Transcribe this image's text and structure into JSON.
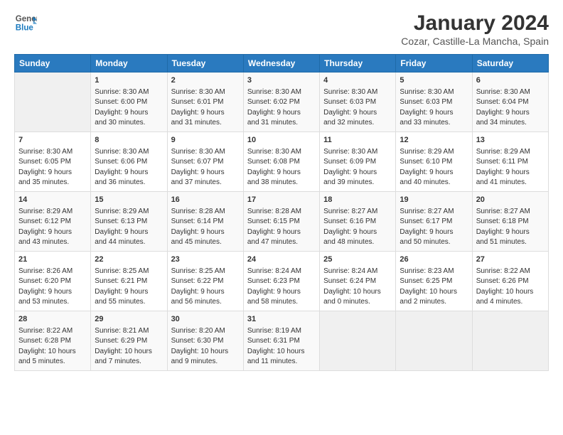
{
  "logo": {
    "line1": "General",
    "line2": "Blue"
  },
  "title": "January 2024",
  "subtitle": "Cozar, Castille-La Mancha, Spain",
  "days_of_week": [
    "Sunday",
    "Monday",
    "Tuesday",
    "Wednesday",
    "Thursday",
    "Friday",
    "Saturday"
  ],
  "weeks": [
    [
      {
        "day": "",
        "info": ""
      },
      {
        "day": "1",
        "info": "Sunrise: 8:30 AM\nSunset: 6:00 PM\nDaylight: 9 hours\nand 30 minutes."
      },
      {
        "day": "2",
        "info": "Sunrise: 8:30 AM\nSunset: 6:01 PM\nDaylight: 9 hours\nand 31 minutes."
      },
      {
        "day": "3",
        "info": "Sunrise: 8:30 AM\nSunset: 6:02 PM\nDaylight: 9 hours\nand 31 minutes."
      },
      {
        "day": "4",
        "info": "Sunrise: 8:30 AM\nSunset: 6:03 PM\nDaylight: 9 hours\nand 32 minutes."
      },
      {
        "day": "5",
        "info": "Sunrise: 8:30 AM\nSunset: 6:03 PM\nDaylight: 9 hours\nand 33 minutes."
      },
      {
        "day": "6",
        "info": "Sunrise: 8:30 AM\nSunset: 6:04 PM\nDaylight: 9 hours\nand 34 minutes."
      }
    ],
    [
      {
        "day": "7",
        "info": "Sunrise: 8:30 AM\nSunset: 6:05 PM\nDaylight: 9 hours\nand 35 minutes."
      },
      {
        "day": "8",
        "info": "Sunrise: 8:30 AM\nSunset: 6:06 PM\nDaylight: 9 hours\nand 36 minutes."
      },
      {
        "day": "9",
        "info": "Sunrise: 8:30 AM\nSunset: 6:07 PM\nDaylight: 9 hours\nand 37 minutes."
      },
      {
        "day": "10",
        "info": "Sunrise: 8:30 AM\nSunset: 6:08 PM\nDaylight: 9 hours\nand 38 minutes."
      },
      {
        "day": "11",
        "info": "Sunrise: 8:30 AM\nSunset: 6:09 PM\nDaylight: 9 hours\nand 39 minutes."
      },
      {
        "day": "12",
        "info": "Sunrise: 8:29 AM\nSunset: 6:10 PM\nDaylight: 9 hours\nand 40 minutes."
      },
      {
        "day": "13",
        "info": "Sunrise: 8:29 AM\nSunset: 6:11 PM\nDaylight: 9 hours\nand 41 minutes."
      }
    ],
    [
      {
        "day": "14",
        "info": "Sunrise: 8:29 AM\nSunset: 6:12 PM\nDaylight: 9 hours\nand 43 minutes."
      },
      {
        "day": "15",
        "info": "Sunrise: 8:29 AM\nSunset: 6:13 PM\nDaylight: 9 hours\nand 44 minutes."
      },
      {
        "day": "16",
        "info": "Sunrise: 8:28 AM\nSunset: 6:14 PM\nDaylight: 9 hours\nand 45 minutes."
      },
      {
        "day": "17",
        "info": "Sunrise: 8:28 AM\nSunset: 6:15 PM\nDaylight: 9 hours\nand 47 minutes."
      },
      {
        "day": "18",
        "info": "Sunrise: 8:27 AM\nSunset: 6:16 PM\nDaylight: 9 hours\nand 48 minutes."
      },
      {
        "day": "19",
        "info": "Sunrise: 8:27 AM\nSunset: 6:17 PM\nDaylight: 9 hours\nand 50 minutes."
      },
      {
        "day": "20",
        "info": "Sunrise: 8:27 AM\nSunset: 6:18 PM\nDaylight: 9 hours\nand 51 minutes."
      }
    ],
    [
      {
        "day": "21",
        "info": "Sunrise: 8:26 AM\nSunset: 6:20 PM\nDaylight: 9 hours\nand 53 minutes."
      },
      {
        "day": "22",
        "info": "Sunrise: 8:25 AM\nSunset: 6:21 PM\nDaylight: 9 hours\nand 55 minutes."
      },
      {
        "day": "23",
        "info": "Sunrise: 8:25 AM\nSunset: 6:22 PM\nDaylight: 9 hours\nand 56 minutes."
      },
      {
        "day": "24",
        "info": "Sunrise: 8:24 AM\nSunset: 6:23 PM\nDaylight: 9 hours\nand 58 minutes."
      },
      {
        "day": "25",
        "info": "Sunrise: 8:24 AM\nSunset: 6:24 PM\nDaylight: 10 hours\nand 0 minutes."
      },
      {
        "day": "26",
        "info": "Sunrise: 8:23 AM\nSunset: 6:25 PM\nDaylight: 10 hours\nand 2 minutes."
      },
      {
        "day": "27",
        "info": "Sunrise: 8:22 AM\nSunset: 6:26 PM\nDaylight: 10 hours\nand 4 minutes."
      }
    ],
    [
      {
        "day": "28",
        "info": "Sunrise: 8:22 AM\nSunset: 6:28 PM\nDaylight: 10 hours\nand 5 minutes."
      },
      {
        "day": "29",
        "info": "Sunrise: 8:21 AM\nSunset: 6:29 PM\nDaylight: 10 hours\nand 7 minutes."
      },
      {
        "day": "30",
        "info": "Sunrise: 8:20 AM\nSunset: 6:30 PM\nDaylight: 10 hours\nand 9 minutes."
      },
      {
        "day": "31",
        "info": "Sunrise: 8:19 AM\nSunset: 6:31 PM\nDaylight: 10 hours\nand 11 minutes."
      },
      {
        "day": "",
        "info": ""
      },
      {
        "day": "",
        "info": ""
      },
      {
        "day": "",
        "info": ""
      }
    ]
  ]
}
